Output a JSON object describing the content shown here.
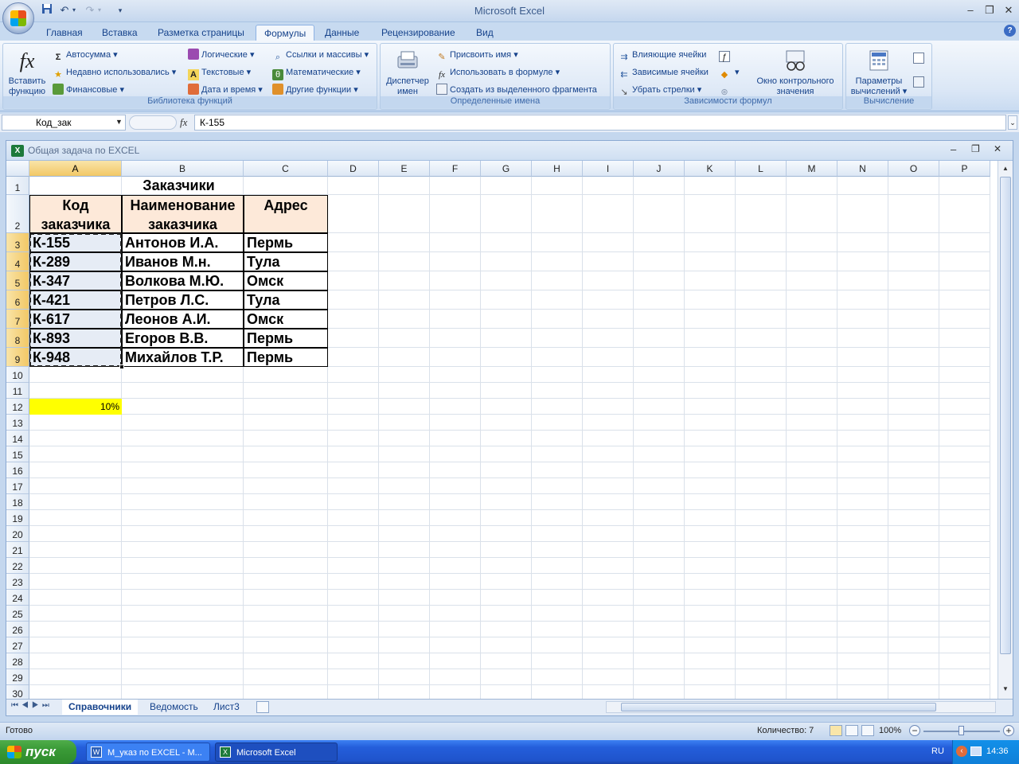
{
  "app": {
    "title": "Microsoft Excel",
    "qat": {
      "save_icon": "save-icon",
      "undo_icon": "undo-icon",
      "redo_icon": "redo-icon",
      "customize_icon": "chevron-down-icon"
    },
    "window_controls": {
      "minimize": "–",
      "restore": "❐",
      "close": "✕"
    }
  },
  "tabs": [
    {
      "label": "Главная"
    },
    {
      "label": "Вставка"
    },
    {
      "label": "Разметка страницы"
    },
    {
      "label": "Формулы",
      "active": true
    },
    {
      "label": "Данные"
    },
    {
      "label": "Рецензирование"
    },
    {
      "label": "Вид"
    }
  ],
  "ribbon": {
    "lib": {
      "label": "Библиотека функций",
      "insert_function": "Вставить функцию",
      "insert_function_l1": "Вставить",
      "insert_function_l2": "функцию",
      "autosum": "Автосумма",
      "recent": "Недавно использовались",
      "financial": "Финансовые",
      "logical": "Логические",
      "text": "Текстовые",
      "datetime": "Дата и время",
      "lookup": "Ссылки и массивы",
      "math": "Математические",
      "other": "Другие функции"
    },
    "names": {
      "label": "Определенные имена",
      "manager_l1": "Диспетчер",
      "manager_l2": "имен",
      "define": "Присвоить имя",
      "use": "Использовать в формуле",
      "create": "Создать из выделенного фрагмента"
    },
    "audit": {
      "label": "Зависимости формул",
      "precedents": "Влияющие ячейки",
      "dependents": "Зависимые ячейки",
      "remove": "Убрать стрелки",
      "watch_l1": "Окно контрольного",
      "watch_l2": "значения"
    },
    "calc": {
      "label": "Вычисление",
      "options_l1": "Параметры",
      "options_l2": "вычислений"
    }
  },
  "formula_bar": {
    "name_box": "Код_зак",
    "fx": "fx",
    "formula": "К-155"
  },
  "workbook": {
    "title": "Общая задача по EXCEL",
    "columns": [
      "A",
      "B",
      "C",
      "D",
      "E",
      "F",
      "G",
      "H",
      "I",
      "J",
      "K",
      "L",
      "M",
      "N",
      "O",
      "P"
    ],
    "rows": [
      "1",
      "2",
      "3",
      "4",
      "5",
      "6",
      "7",
      "8",
      "9",
      "10",
      "11",
      "12",
      "13",
      "14",
      "15",
      "16",
      "17",
      "18",
      "19",
      "20",
      "21",
      "22",
      "23",
      "24",
      "25",
      "26",
      "27",
      "28",
      "29",
      "30"
    ],
    "table": {
      "title": "Заказчики",
      "headers": [
        "Код заказчика",
        "Наименование заказчика",
        "Адрес"
      ],
      "header_lines": [
        [
          "Код",
          "заказчика"
        ],
        [
          "Наименование",
          "заказчика"
        ],
        [
          "Адрес",
          ""
        ]
      ],
      "data": [
        [
          "К-155",
          "Антонов И.А.",
          "Пермь"
        ],
        [
          "К-289",
          "Иванов М.н.",
          "Тула"
        ],
        [
          "К-347",
          "Волкова М.Ю.",
          "Омск"
        ],
        [
          "К-421",
          "Петров Л.С.",
          "Тула"
        ],
        [
          "К-617",
          "Леонов А.И.",
          "Омск"
        ],
        [
          "К-893",
          "Егоров В.В.",
          "Пермь"
        ],
        [
          "К-948",
          "Михайлов Т.Р.",
          "Пермь"
        ]
      ],
      "percent_cell": "10%"
    },
    "sheets": [
      {
        "label": "Справочники",
        "active": true
      },
      {
        "label": "Ведомость"
      },
      {
        "label": "Лист3"
      }
    ]
  },
  "status": {
    "ready": "Готово",
    "count": "Количество: 7",
    "zoom": "100%"
  },
  "taskbar": {
    "start": "пуск",
    "items": [
      "М_указ по EXCEL - M...",
      "Microsoft Excel"
    ],
    "lang": "RU",
    "time": "14:36"
  },
  "colors": {
    "header_fill": "#fde9d9",
    "selection_fill": "#e6ecf5",
    "percent_fill": "#ffff00",
    "accent": "#15428b"
  }
}
